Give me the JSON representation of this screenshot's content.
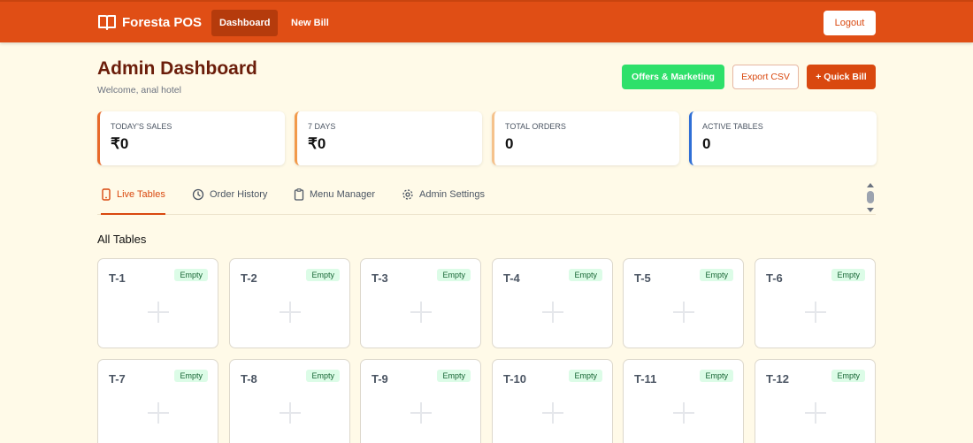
{
  "nav": {
    "brand": "Foresta POS",
    "links": [
      {
        "label": "Dashboard",
        "active": true
      },
      {
        "label": "New Bill",
        "active": false
      }
    ],
    "logout": "Logout"
  },
  "header": {
    "title": "Admin Dashboard",
    "welcome": "Welcome, anal hotel"
  },
  "actions": {
    "offers": "Offers & Marketing",
    "export": "Export CSV",
    "quick_bill": "+ Quick Bill"
  },
  "stats": [
    {
      "label": "TODAY'S SALES",
      "value": "₹0",
      "color": "#e8692a"
    },
    {
      "label": "7 DAYS",
      "value": "₹0",
      "color": "#f29a4a"
    },
    {
      "label": "TOTAL ORDERS",
      "value": "0",
      "color": "#f5c28c"
    },
    {
      "label": "ACTIVE TABLES",
      "value": "0",
      "color": "#2f6fd6"
    }
  ],
  "tabs": [
    {
      "label": "Live Tables",
      "icon": "tablet-icon",
      "active": true
    },
    {
      "label": "Order History",
      "icon": "clock-icon",
      "active": false
    },
    {
      "label": "Menu Manager",
      "icon": "clipboard-icon",
      "active": false
    },
    {
      "label": "Admin Settings",
      "icon": "gear-icon",
      "active": false
    }
  ],
  "section": {
    "title": "All Tables"
  },
  "tables": [
    {
      "name": "T-1",
      "status": "Empty"
    },
    {
      "name": "T-2",
      "status": "Empty"
    },
    {
      "name": "T-3",
      "status": "Empty"
    },
    {
      "name": "T-4",
      "status": "Empty"
    },
    {
      "name": "T-5",
      "status": "Empty"
    },
    {
      "name": "T-6",
      "status": "Empty"
    },
    {
      "name": "T-7",
      "status": "Empty"
    },
    {
      "name": "T-8",
      "status": "Empty"
    },
    {
      "name": "T-9",
      "status": "Empty"
    },
    {
      "name": "T-10",
      "status": "Empty"
    },
    {
      "name": "T-11",
      "status": "Empty"
    },
    {
      "name": "T-12",
      "status": "Empty"
    }
  ],
  "colors": {
    "primary": "#e04e15",
    "accent": "#d9480f",
    "success": "#2ee06a",
    "background": "#fffae8"
  }
}
